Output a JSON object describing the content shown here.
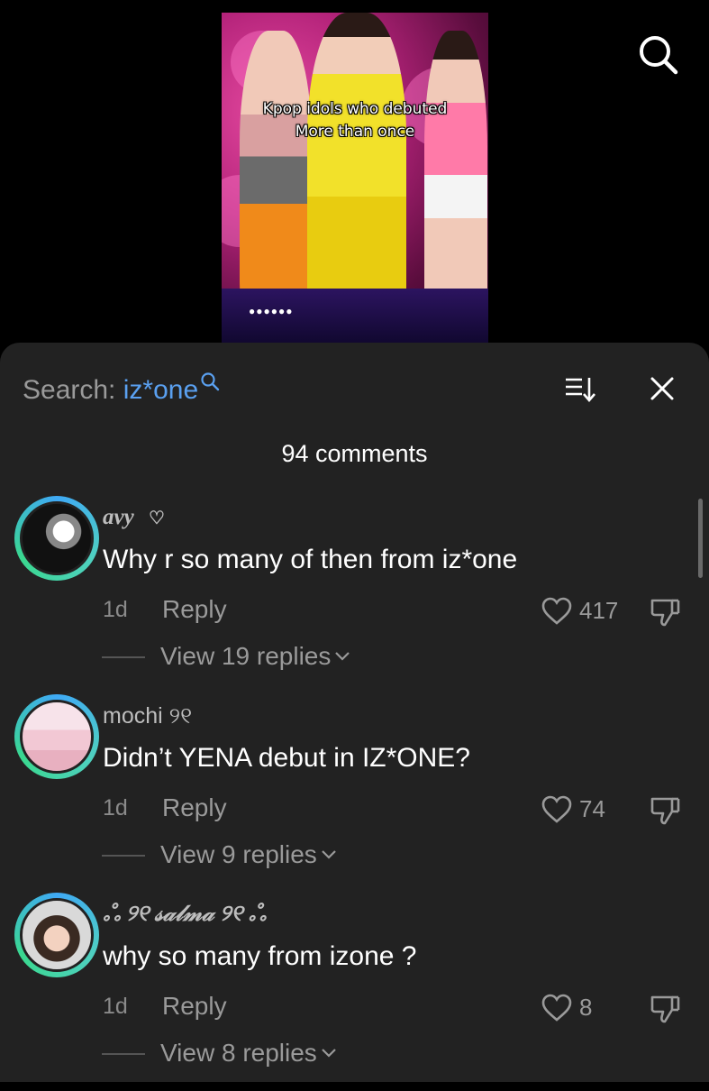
{
  "video": {
    "caption_line1": "Kpop idols who debuted",
    "caption_line2": "More than once",
    "search_icon": "search-icon"
  },
  "header": {
    "search_prefix": "Search: ",
    "search_query": "iz*one",
    "sort_icon": "sort-icon",
    "close_icon": "close-icon"
  },
  "comment_count": "94 comments",
  "colors": {
    "sheet_bg": "#222222",
    "accent_query": "#5aa0f0",
    "secondary_text": "#9a9a9a"
  },
  "comments": [
    {
      "username": "avy",
      "username_suffix": "♡",
      "text": "Why r so many of then from iz*one",
      "time": "1d",
      "reply_label": "Reply",
      "likes": "417",
      "view_replies": "View 19 replies"
    },
    {
      "username": "mochi",
      "username_suffix": "୨୧",
      "text": "Didn’t YENA debut in IZ*ONE?",
      "time": "1d",
      "reply_label": "Reply",
      "likes": "74",
      "view_replies": "View 9 replies"
    },
    {
      "username": "ஃ ୨୧ 𝓈𝒶𝓁𝓂𝒶 ୨୧ ஃ",
      "username_suffix": "",
      "text": "why so many from izone ?",
      "time": "1d",
      "reply_label": "Reply",
      "likes": "8",
      "view_replies": "View 8 replies"
    }
  ]
}
